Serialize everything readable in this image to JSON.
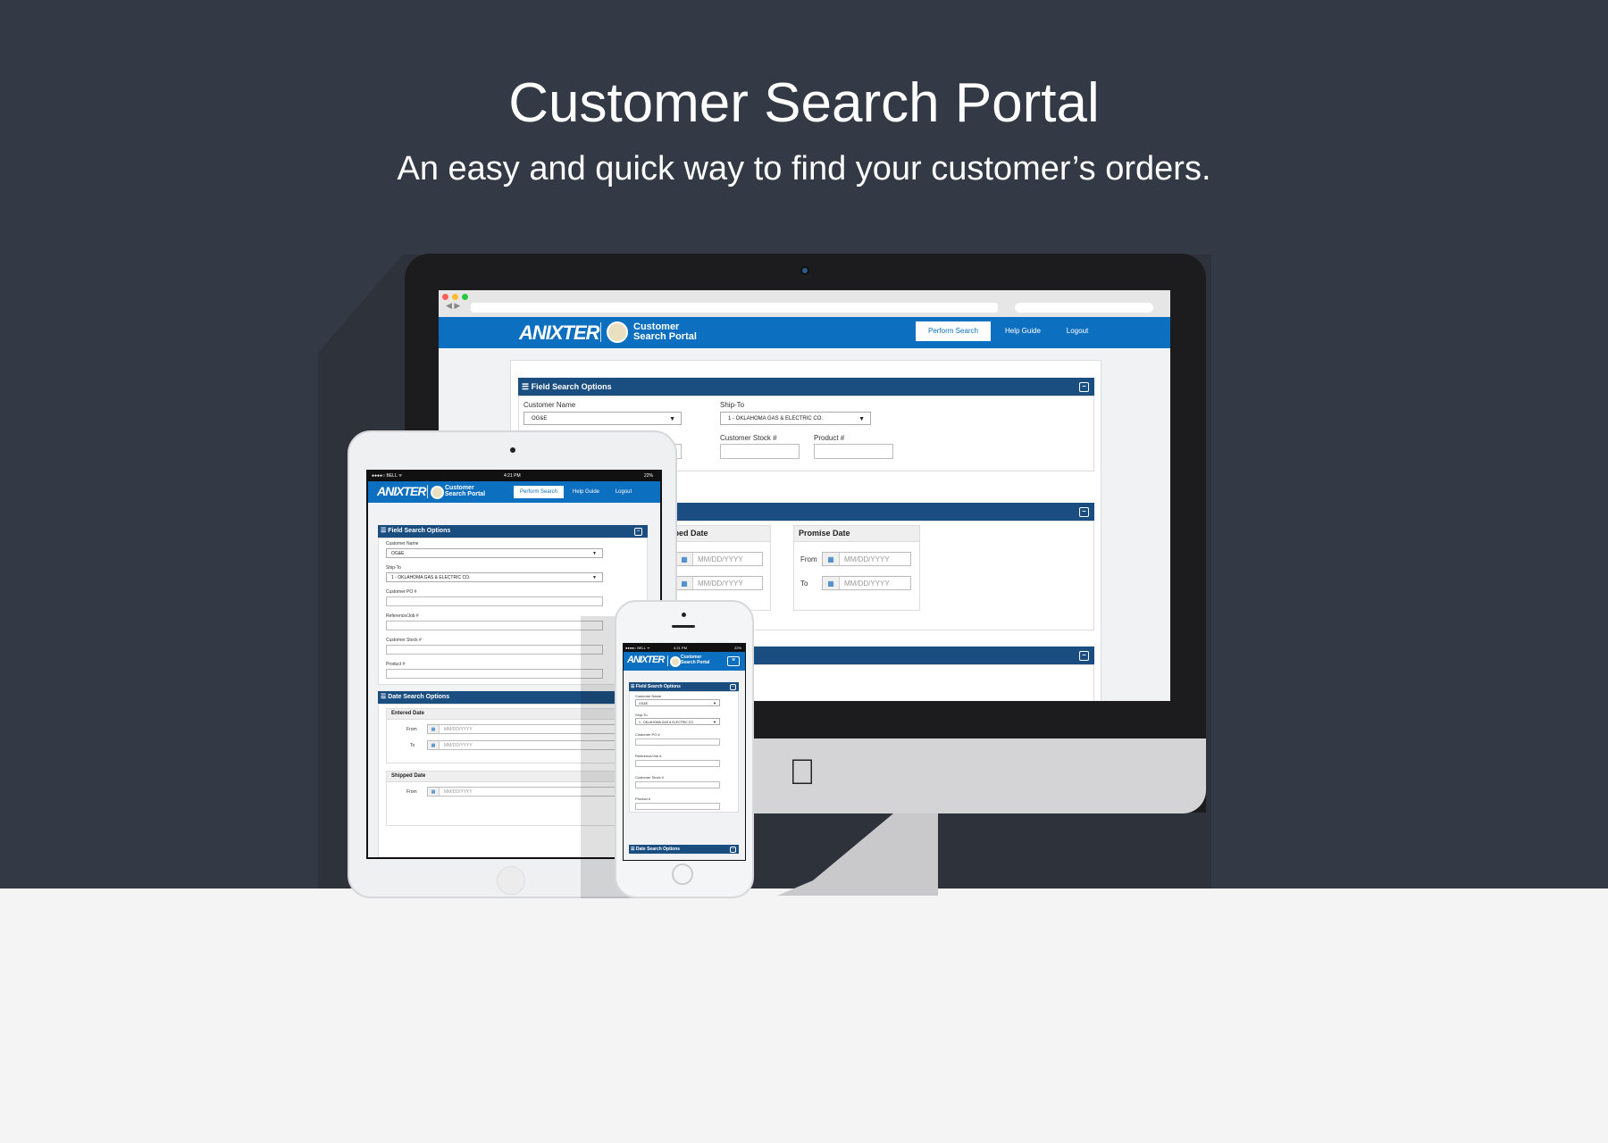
{
  "hero": {
    "title": "Customer Search Portal",
    "subtitle": "An easy and quick way to find your customer’s orders."
  },
  "app": {
    "brand": "ANIXTER",
    "portal_line1": "Customer",
    "portal_line2": "Search Portal",
    "nav": {
      "perform_search": "Perform Search",
      "help_guide": "Help Guide",
      "logout": "Logout"
    }
  },
  "desktop": {
    "field_panel_title": "Field Search Options",
    "customer_name_label": "Customer Name",
    "customer_name_value": "OG&E",
    "ship_to_label": "Ship-To",
    "ship_to_value": "1 - OKLAHOMA GAS & ELECTRIC CO.",
    "customer_stock_label": "Customer Stock #",
    "product_label": "Product #",
    "shipped_date_title": "Shipped Date",
    "promise_date_title": "Promise Date",
    "from_label": "From",
    "to_label": "To",
    "date_placeholder": "MM/DD/YYYY"
  },
  "tablet": {
    "status_carrier": "●●●●○ BELL ᯤ",
    "status_time": "4:21 PM",
    "status_battery": "22%",
    "field_panel_title": "Field Search Options",
    "customer_name_label": "Customer Name",
    "customer_name_value": "OG&E",
    "ship_to_label": "Ship-To",
    "ship_to_value": "1 - OKLAHOMA GAS & ELECTRIC CO.",
    "customer_po_label": "Customer PO #",
    "reference_label": "Reference/Job #",
    "customer_stock_label": "Customer Stock #",
    "product_label": "Product #",
    "date_panel_title": "Date Search Options",
    "entered_date_title": "Entered Date",
    "shipped_date_title": "Shipped Date",
    "from_label": "From",
    "to_label": "To",
    "date_placeholder": "MM/DD/YYYY"
  },
  "phone": {
    "status_carrier": "●●●●○ BELL ᯤ",
    "status_time": "4:21 PM",
    "status_battery": "22%",
    "field_panel_title": "Field Search Options",
    "customer_name_label": "Customer Name",
    "customer_name_value": "OG&E",
    "ship_to_label": "Ship-To",
    "ship_to_value": "1 - OKLAHOMA GAS & ELECTRIC CO.",
    "customer_po_label": "Customer PO #",
    "reference_label": "Reference/Job #",
    "customer_stock_label": "Customer Stock #",
    "product_label": "Product #",
    "date_panel_title": "Date Search Options"
  },
  "colors": {
    "background": "#343a45",
    "brand_blue": "#0d6fbf",
    "panel_blue": "#1b4e80"
  }
}
